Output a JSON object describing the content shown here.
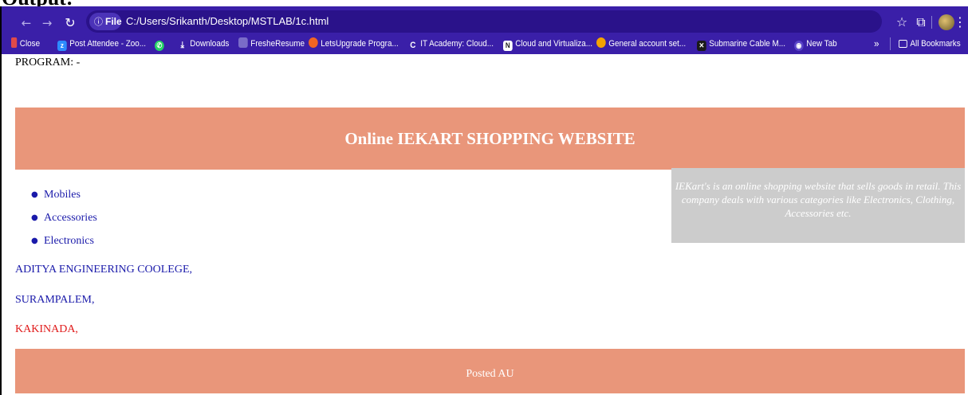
{
  "document": {
    "heading": "Output:"
  },
  "browser": {
    "site_chip_label": "File",
    "url": "C:/Users/Srikanth/Desktop/MSTLAB/1c.html",
    "icons": {
      "back": "arrow-left-icon",
      "forward": "arrow-right-icon",
      "reload": "reload-icon",
      "info": "info-icon",
      "bookmark_star": "star-icon",
      "extensions": "puzzle-icon",
      "menu": "kebab-menu-icon"
    },
    "bookmarks": [
      {
        "label": "Close",
        "icon": "close-tab-icon",
        "color": "#e04a4a"
      },
      {
        "label": "Post Attendee - Zoo...",
        "icon": "zoom-icon",
        "color": "#2d8cff"
      },
      {
        "label": "",
        "icon": "whatsapp-icon",
        "color": "#25d366"
      },
      {
        "label": "Downloads",
        "icon": "download-icon",
        "color": "#3a1fa8"
      },
      {
        "label": "FresheResume",
        "icon": "resume-icon",
        "color": "#7a6cc8"
      },
      {
        "label": "LetsUpgrade Progra...",
        "icon": "letsupgrade-icon",
        "color": "#f26522"
      },
      {
        "label": "IT Academy: Cloud...",
        "icon": "academy-icon",
        "color": "#3a1fa8"
      },
      {
        "label": "Cloud and Virtualiza...",
        "icon": "notion-icon",
        "color": "#1a1a1a"
      },
      {
        "label": "General account set...",
        "icon": "account-icon",
        "color": "#f4a300"
      },
      {
        "label": "Submarine Cable M...",
        "icon": "submarine-icon",
        "color": "#1a1a1a"
      },
      {
        "label": "New Tab",
        "icon": "chrome-icon",
        "color": "#3a1fa8"
      }
    ],
    "overflow_label": "»",
    "all_bookmarks_label": "All Bookmarks"
  },
  "page": {
    "program_label": "PROGRAM: -",
    "header_title": "Online IEKART SHOPPING WEBSITE",
    "about_text": "IEKart's is an online shopping website that sells goods in retail. This company deals with various categories like Electronics, Clothing, Accessories etc.",
    "menu": [
      "Mobiles",
      "Accessories",
      "Electronics"
    ],
    "address": [
      {
        "text": "ADITYA ENGINEERING COOLEGE,",
        "color": "#1a1aaa"
      },
      {
        "text": "SURAMPALEM,",
        "color": "#1a1aaa"
      },
      {
        "text": "KAKINADA,",
        "color": "#e01b1b"
      }
    ],
    "footer_text": "Posted AU",
    "colors": {
      "header_bg": "#e9967a",
      "about_bg": "#cccccc",
      "link": "#1a1aaa"
    }
  }
}
